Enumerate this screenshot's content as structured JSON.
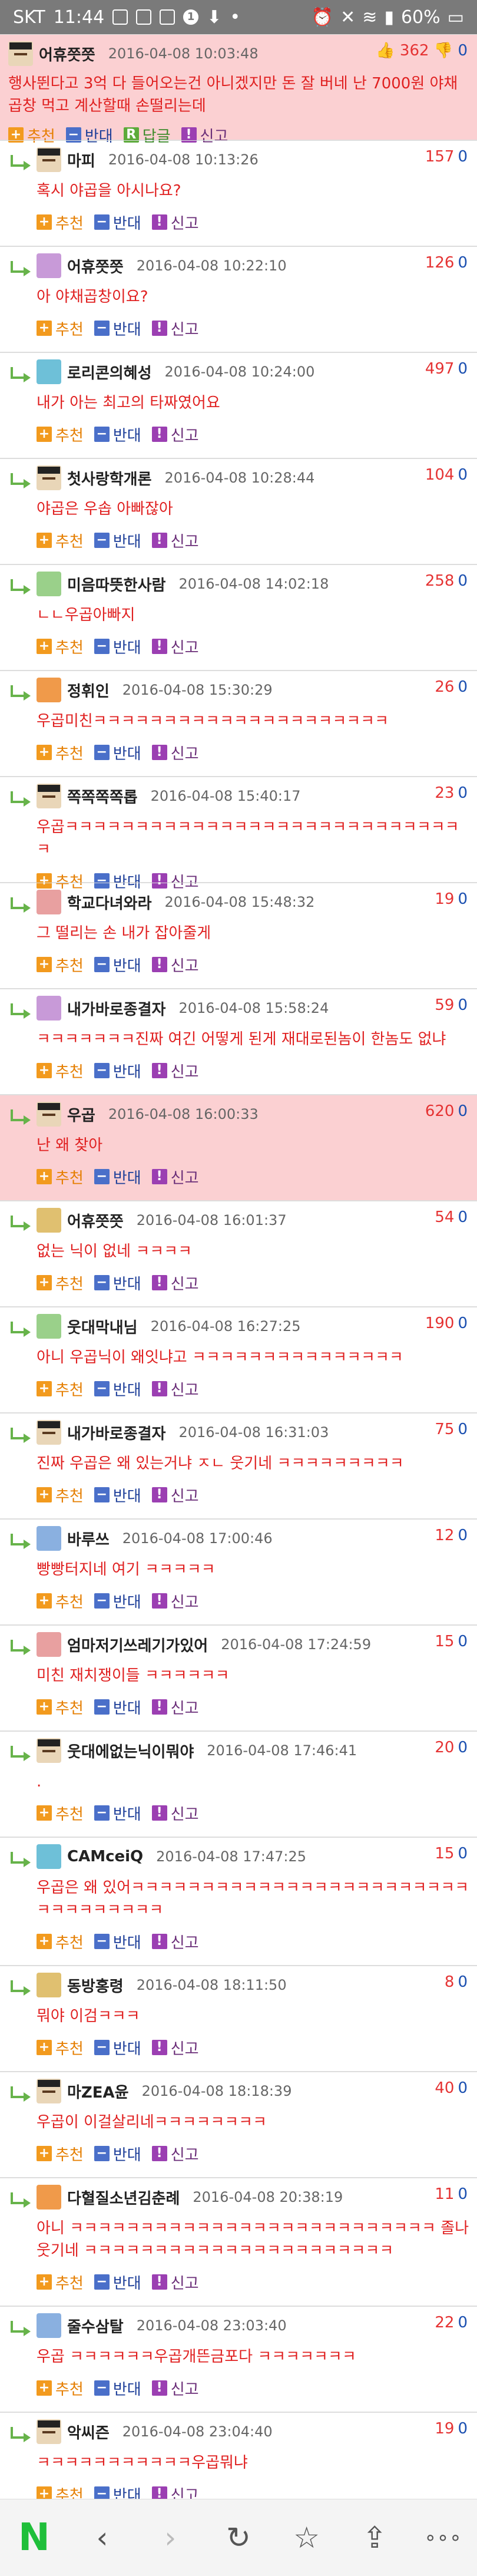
{
  "status": {
    "carrier": "SKT",
    "time": "11:44",
    "battery": "60%",
    "notification_count": "1"
  },
  "actions": {
    "recommend": "추천",
    "oppose": "반대",
    "reply": "답글",
    "report": "신고"
  },
  "top_post": {
    "nick": "어휴쯧쯧",
    "date": "2016-04-08 10:03:48",
    "up": "362",
    "down": "0",
    "body": "행사뛴다고 3억 다 들어오는건 아니겠지만 돈 잘 버네 난 7000원 야채곱창 먹고 계산할때 손떨리는데"
  },
  "comments": [
    {
      "nick": "마피",
      "date": "2016-04-08 10:13:26",
      "up": "157",
      "down": "0",
      "body": "혹시 야곱을 아시나요?"
    },
    {
      "nick": "어휴쯧쯧",
      "date": "2016-04-08 10:22:10",
      "up": "126",
      "down": "0",
      "body": "아 야채곱창이요?"
    },
    {
      "nick": "로리콘의혜성",
      "date": "2016-04-08 10:24:00",
      "up": "497",
      "down": "0",
      "body": "내가 아는 최고의 타짜였어요"
    },
    {
      "nick": "첫사랑학개론",
      "date": "2016-04-08 10:28:44",
      "up": "104",
      "down": "0",
      "body": "야곱은 우솝 아빠잖아"
    },
    {
      "nick": "미음따뜻한사람",
      "date": "2016-04-08 14:02:18",
      "up": "258",
      "down": "0",
      "body": "ㄴㄴ우곱아빠지"
    },
    {
      "nick": "정휘인",
      "date": "2016-04-08 15:30:29",
      "up": "26",
      "down": "0",
      "body": "우곱미친ㅋㅋㅋㅋㅋㅋㅋㅋㅋㅋㅋㅋㅋㅋㅋㅋㅋㅋㅋㅋㅋ"
    },
    {
      "nick": "쪽쪽쪽쪽롭",
      "date": "2016-04-08 15:40:17",
      "up": "23",
      "down": "0",
      "body": "우곱ㅋㅋㅋㅋㅋㅋㅋㅋㅋㅋㅋㅋㅋㅋㅋㅋㅋㅋㅋㅋㅋㅋㅋㅋㅋㅋㅋㅋㅋ"
    },
    {
      "nick": "학교다녀와라",
      "date": "2016-04-08 15:48:32",
      "up": "19",
      "down": "0",
      "body": "그 떨리는 손 내가 잡아줄게"
    },
    {
      "nick": "내가바로종결자",
      "date": "2016-04-08 15:58:24",
      "up": "59",
      "down": "0",
      "body": "ㅋㅋㅋㅋㅋㅋㅋ진짜 여긴 어떻게 된게 재대로된놈이 한놈도 없냐"
    },
    {
      "nick": "우곱",
      "date": "2016-04-08 16:00:33",
      "up": "620",
      "down": "0",
      "body": "난 왜 찾아"
    },
    {
      "nick": "어휴쯧쯧",
      "date": "2016-04-08 16:01:37",
      "up": "54",
      "down": "0",
      "body": "없는 닉이 없네 ㅋㅋㅋㅋ"
    },
    {
      "nick": "웃대막내님",
      "date": "2016-04-08 16:27:25",
      "up": "190",
      "down": "0",
      "body": "아니 우곱닉이 왜잇냐고 ㅋㅋㅋㅋㅋㅋㅋㅋㅋㅋㅋㅋㅋㅋㅋ"
    },
    {
      "nick": "내가바로종결자",
      "date": "2016-04-08 16:31:03",
      "up": "75",
      "down": "0",
      "body": "진짜 우곱은 왜 있는거냐 ㅈㄴ 웃기네 ㅋㅋㅋㅋㅋㅋㅋㅋㅋ"
    },
    {
      "nick": "바루쓰",
      "date": "2016-04-08 17:00:46",
      "up": "12",
      "down": "0",
      "body": "빵빵터지네 여기 ㅋㅋㅋㅋㅋ"
    },
    {
      "nick": "엄마저기쓰레기가있어",
      "date": "2016-04-08 17:24:59",
      "up": "15",
      "down": "0",
      "body": "미친 재치쟁이들 ㅋㅋㅋㅋㅋㅋ"
    },
    {
      "nick": "웃대에없는닉이뭐야",
      "date": "2016-04-08 17:46:41",
      "up": "20",
      "down": "0",
      "body": "."
    },
    {
      "nick": "CAMceiQ",
      "date": "2016-04-08 17:47:25",
      "up": "15",
      "down": "0",
      "body": "우곱은 왜 있어ㅋㅋㅋㅋㅋㅋㅋㅋㅋㅋㅋㅋㅋㅋㅋㅋㅋㅋㅋㅋㅋㅋㅋㅋㅋㅋㅋㅋㅋㅋㅋㅋㅋ"
    },
    {
      "nick": "동방홍령",
      "date": "2016-04-08 18:11:50",
      "up": "8",
      "down": "0",
      "body": "뭐야 이검ㅋㅋㅋ"
    },
    {
      "nick": "마ZEA윤",
      "date": "2016-04-08 18:18:39",
      "up": "40",
      "down": "0",
      "body": "우곱이 이걸살리네ㅋㅋㅋㅋㅋㅋㅋㅋ"
    },
    {
      "nick": "다혈질소년김춘례",
      "date": "2016-04-08 20:38:19",
      "up": "11",
      "down": "0",
      "body": "아니 ㅋㅋㅋㅋㅋㅋㅋㅋㅋㅋㅋㅋㅋㅋㅋㅋㅋㅋㅋㅋㅋㅋㅋㅋㅋㅋ 졸나웃기네 ㅋㅋㅋㅋㅋㅋㅋㅋㅋㅋㅋㅋㅋㅋㅋㅋㅋㅋㅋㅋㅋㅋ"
    },
    {
      "nick": "줄수삼탈",
      "date": "2016-04-08 23:03:40",
      "up": "22",
      "down": "0",
      "body": "우곱 ㅋㅋㅋㅋㅋㅋ우곱개뜬금포다 ㅋㅋㅋㅋㅋㅋㅋ"
    },
    {
      "nick": "악씨즌",
      "date": "2016-04-08 23:04:40",
      "up": "19",
      "down": "0",
      "body": "ㅋㅋㅋㅋㅋㅋㅋㅋㅋㅋㅋ우곱뭐냐"
    }
  ],
  "navbar": {
    "home_label": "N",
    "back_label": "‹",
    "forward_label": "›",
    "refresh_label": "↻",
    "bookmark_label": "☆",
    "share_label": "⇪",
    "more_label": "∘∘∘"
  }
}
